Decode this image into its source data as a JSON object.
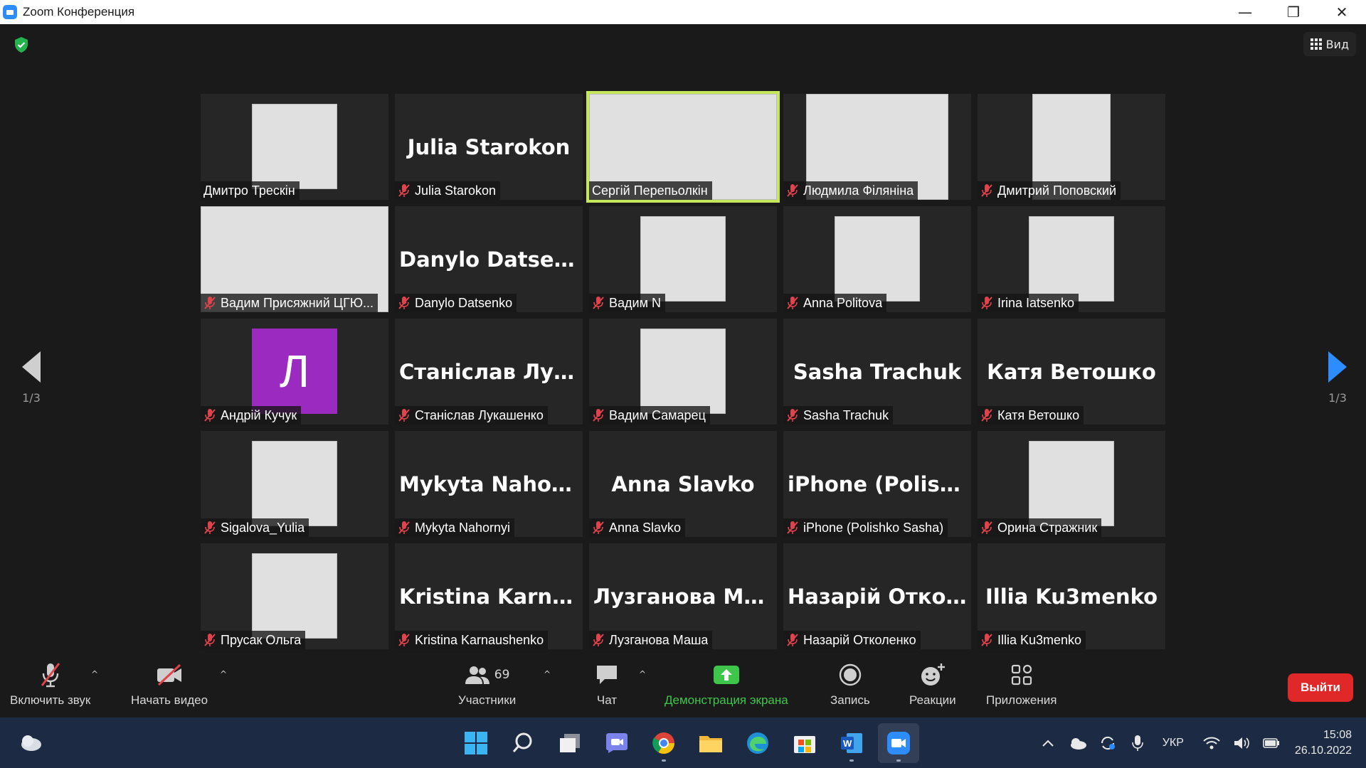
{
  "window": {
    "title": "Zoom Конференция",
    "minimize": "—",
    "maximize": "❐",
    "close": "✕"
  },
  "view": {
    "label": "Вид"
  },
  "pager": {
    "left": "1/3",
    "right": "1/3"
  },
  "tiles": [
    {
      "big": "",
      "label": "Дмитро Трескін",
      "muted": false,
      "media": "photo"
    },
    {
      "big": "Julia Starokon",
      "label": "Julia Starokon",
      "muted": true,
      "media": "name"
    },
    {
      "big": "",
      "label": "Сергій Перепьолкін",
      "muted": false,
      "media": "video",
      "active": true
    },
    {
      "big": "",
      "label": "Людмила Філяніна",
      "muted": true,
      "media": "photo-wide"
    },
    {
      "big": "",
      "label": "Дмитрий Поповский",
      "muted": true,
      "media": "photo"
    },
    {
      "big": "",
      "label": "Вадим Присяжний ЦГЮ...",
      "muted": true,
      "media": "video"
    },
    {
      "big": "Danylo Datsenko",
      "label": "Danylo Datsenko",
      "muted": true,
      "media": "name"
    },
    {
      "big": "",
      "label": "Вадим N",
      "muted": true,
      "media": "photo"
    },
    {
      "big": "",
      "label": "Anna Politova",
      "muted": true,
      "media": "photo"
    },
    {
      "big": "",
      "label": "Irina Iatsenko",
      "muted": true,
      "media": "photo"
    },
    {
      "big": "",
      "label": "Андрій Кучук",
      "muted": true,
      "media": "letter",
      "letter": "Л"
    },
    {
      "big": "Станіслав  Лука...",
      "label": "Станіслав Лукашенко",
      "muted": true,
      "media": "name"
    },
    {
      "big": "",
      "label": "Вадим Самарец",
      "muted": true,
      "media": "photo"
    },
    {
      "big": "Sasha Trachuk",
      "label": "Sasha Trachuk",
      "muted": true,
      "media": "name"
    },
    {
      "big": "Катя Ветошко",
      "label": "Катя Ветошко",
      "muted": true,
      "media": "name"
    },
    {
      "big": "",
      "label": "Sigalova_Yulia",
      "muted": true,
      "media": "photo"
    },
    {
      "big": "Mykyta Nahornyi",
      "label": "Mykyta Nahornyi",
      "muted": true,
      "media": "name"
    },
    {
      "big": "Anna Slavko",
      "label": "Anna Slavko",
      "muted": true,
      "media": "name"
    },
    {
      "big": "iPhone  (Polishk...",
      "label": "iPhone (Polishko Sasha)",
      "muted": true,
      "media": "name"
    },
    {
      "big": "",
      "label": "Орина Стражник",
      "muted": true,
      "media": "photo"
    },
    {
      "big": "",
      "label": "Прусак Ольга",
      "muted": true,
      "media": "photo"
    },
    {
      "big": "Kristina  Karnau...",
      "label": "Kristina Karnaushenko",
      "muted": true,
      "media": "name"
    },
    {
      "big": "Лузганова Маша",
      "label": "Лузганова Маша",
      "muted": true,
      "media": "name"
    },
    {
      "big": "Назарій  Откол...",
      "label": "Назарій Отколенко",
      "muted": true,
      "media": "name"
    },
    {
      "big": "Illia Ku3menko",
      "label": "Illia Ku3menko",
      "muted": true,
      "media": "name"
    }
  ],
  "controls": {
    "audio": "Включить звук",
    "video": "Начать видео",
    "participants": "Участники",
    "participants_count": "69",
    "chat": "Чат",
    "share": "Демонстрация экрана",
    "record": "Запись",
    "reactions": "Реакции",
    "apps": "Приложения",
    "leave": "Выйти"
  },
  "taskbar": {
    "language": "УКР",
    "time": "15:08",
    "date": "26.10.2022"
  },
  "colors": {
    "active_speaker": "#c6e65b",
    "share_green": "#3ec64b",
    "leave_red": "#e02828",
    "zoom_blue": "#2d8cff",
    "muted_red": "#e0434b"
  }
}
